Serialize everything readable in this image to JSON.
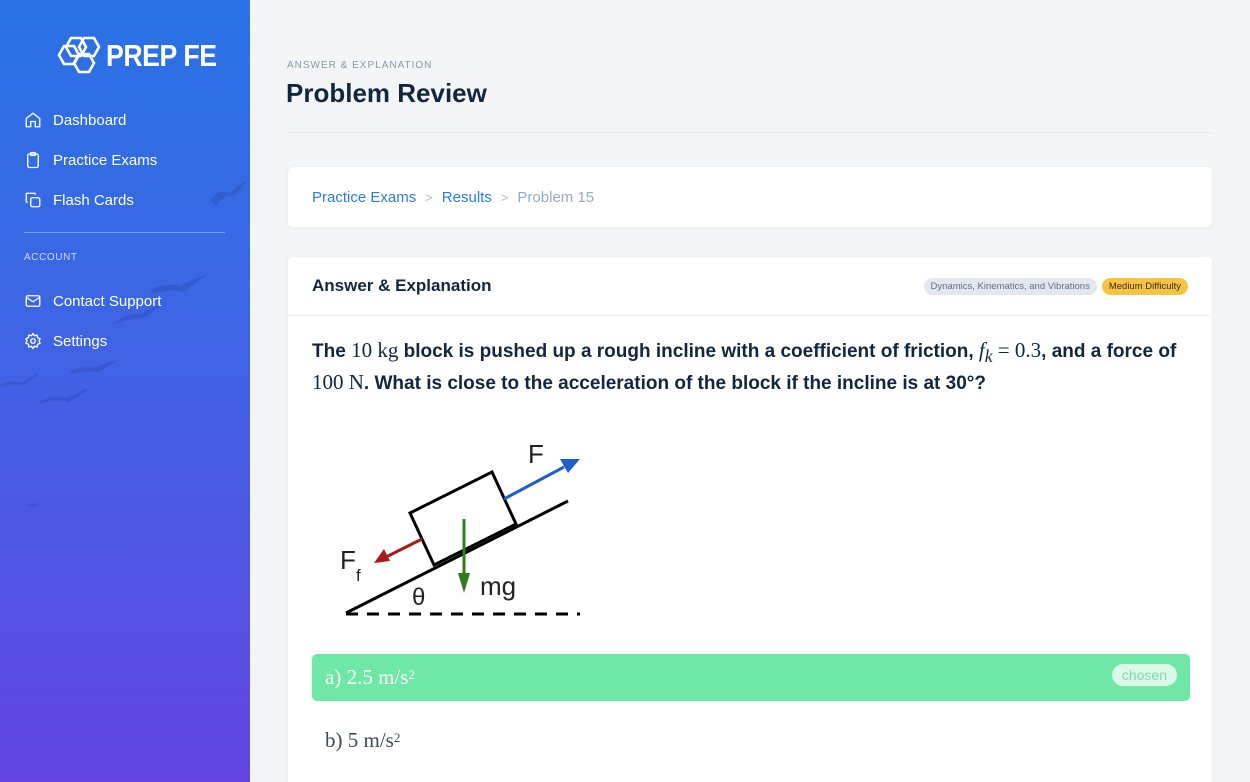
{
  "brand": {
    "name": "PREP FE"
  },
  "sidebar": {
    "main_items": [
      {
        "label": "Dashboard",
        "icon": "home-icon"
      },
      {
        "label": "Practice Exams",
        "icon": "clipboard-icon"
      },
      {
        "label": "Flash Cards",
        "icon": "copy-icon"
      }
    ],
    "account_heading": "ACCOUNT",
    "account_items": [
      {
        "label": "Contact Support",
        "icon": "mail-icon"
      },
      {
        "label": "Settings",
        "icon": "gear-icon"
      }
    ]
  },
  "header": {
    "pretitle": "ANSWER & EXPLANATION",
    "title": "Problem Review"
  },
  "breadcrumb": {
    "items": [
      "Practice Exams",
      "Results",
      "Problem 15"
    ],
    "separator": ">"
  },
  "qa": {
    "title": "Answer & Explanation",
    "topic_badge": "Dynamics, Kinematics, and Vibrations",
    "difficulty_badge": "Medium Difficulty",
    "question": {
      "t1": "The ",
      "m1": "10  kg",
      "t2": " block is pushed up a rough incline with a coefficient of friction, ",
      "m2_var": "f",
      "m2_sub": "k",
      "m2_rest": " = 0.3",
      "t3": ", and a force of ",
      "m3": "100 N",
      "t4": ". What is close to the acceleration of the block if the incline is at 30°?"
    },
    "diagram_labels": {
      "force": "F",
      "friction": "F",
      "friction_sub": "f",
      "weight": "mg",
      "angle": "θ"
    },
    "answers": [
      {
        "prefix": "a) ",
        "value": "2.5 m/s",
        "exp": "2",
        "chosen": true,
        "chosen_label": "chosen"
      },
      {
        "prefix": "b) ",
        "value": "5 m/s",
        "exp": "2",
        "chosen": false
      }
    ]
  },
  "colors": {
    "sidebar_top": "#2a72e6",
    "sidebar_bottom": "#6445e3",
    "accent": "#2c7be5",
    "chosen_answer": "#6ee7a7",
    "difficulty": "#f6c343",
    "force_arrow": "#1f5fc9",
    "friction_arrow": "#b01818",
    "weight_arrow": "#2f7d1f"
  }
}
